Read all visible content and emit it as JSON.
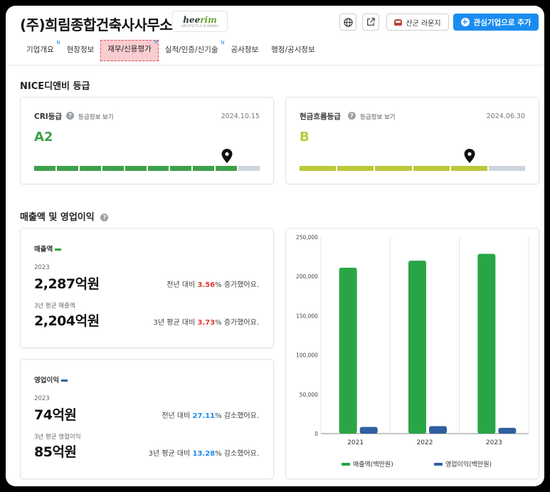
{
  "header": {
    "company": "(주)희림종합건축사사무소",
    "logo_text_a": "hee",
    "logo_text_b": "rim",
    "logo_sub": "ARCHITECTS & PLANNERS",
    "lounge_label": "산군 라운지",
    "add_label": "관심기업으로 추가"
  },
  "tabs": [
    {
      "label": "기업개요",
      "badge": "N"
    },
    {
      "label": "현장정보",
      "badge": ""
    },
    {
      "label": "재무/신용평가",
      "badge": "N"
    },
    {
      "label": "실적/인증/신기술",
      "badge": "N"
    },
    {
      "label": "공사정보",
      "badge": ""
    },
    {
      "label": "행정/공시정보",
      "badge": ""
    }
  ],
  "nice": {
    "title": "NICE디앤비 등급",
    "cri": {
      "label": "CRI등급",
      "link": "등급정보 보기",
      "date": "2024.10.15",
      "grade": "A2",
      "color": "#3fa04a",
      "filled": 9,
      "total": 10
    },
    "cash": {
      "label": "현금흐름등급",
      "link": "등급정보 보기",
      "date": "2024.06.30",
      "grade": "B",
      "color": "#b9c93a",
      "filled": 5,
      "total": 6
    }
  },
  "sales_section": {
    "title": "매출액 및 영업이익",
    "revenue": {
      "label": "매출액",
      "color": "#2aa545",
      "year": "2023",
      "value": "2,287억원",
      "cmp_prefix": "전년 대비 ",
      "cmp_value": "3.56",
      "cmp_suffix": "% 증가했어요.",
      "avg_label": "3년 평균 매출액",
      "avg_value": "2,204억원",
      "avg_cmp_prefix": "3년 평균 대비 ",
      "avg_cmp_value": "3.73",
      "avg_cmp_suffix": "% 증가했어요."
    },
    "profit": {
      "label": "영업이익",
      "color": "#2f5fa0",
      "year": "2023",
      "value": "74억원",
      "cmp_prefix": "전년 대비 ",
      "cmp_value": "27.11",
      "cmp_suffix": "% 감소했어요.",
      "avg_label": "3년 평균 영업이익",
      "avg_value": "85억원",
      "avg_cmp_prefix": "3년 평균 대비 ",
      "avg_cmp_value": "13.28",
      "avg_cmp_suffix": "% 감소했어요."
    }
  },
  "chart_data": {
    "type": "bar",
    "categories": [
      "2021",
      "2022",
      "2023"
    ],
    "series": [
      {
        "name": "매출액(백만원)",
        "color": "#2aa545",
        "values": [
          211000,
          220000,
          228700
        ]
      },
      {
        "name": "영업이익(백만원)",
        "color": "#2f5fa0",
        "values": [
          8500,
          9500,
          7400
        ]
      }
    ],
    "ylim": [
      0,
      250000
    ],
    "yticks": [
      0,
      50000,
      100000,
      150000,
      200000,
      250000
    ],
    "ytick_labels": [
      "0",
      "50,000",
      "100,000",
      "150,000",
      "200,000",
      "250,000"
    ],
    "legend": "bottom",
    "grid": true
  }
}
